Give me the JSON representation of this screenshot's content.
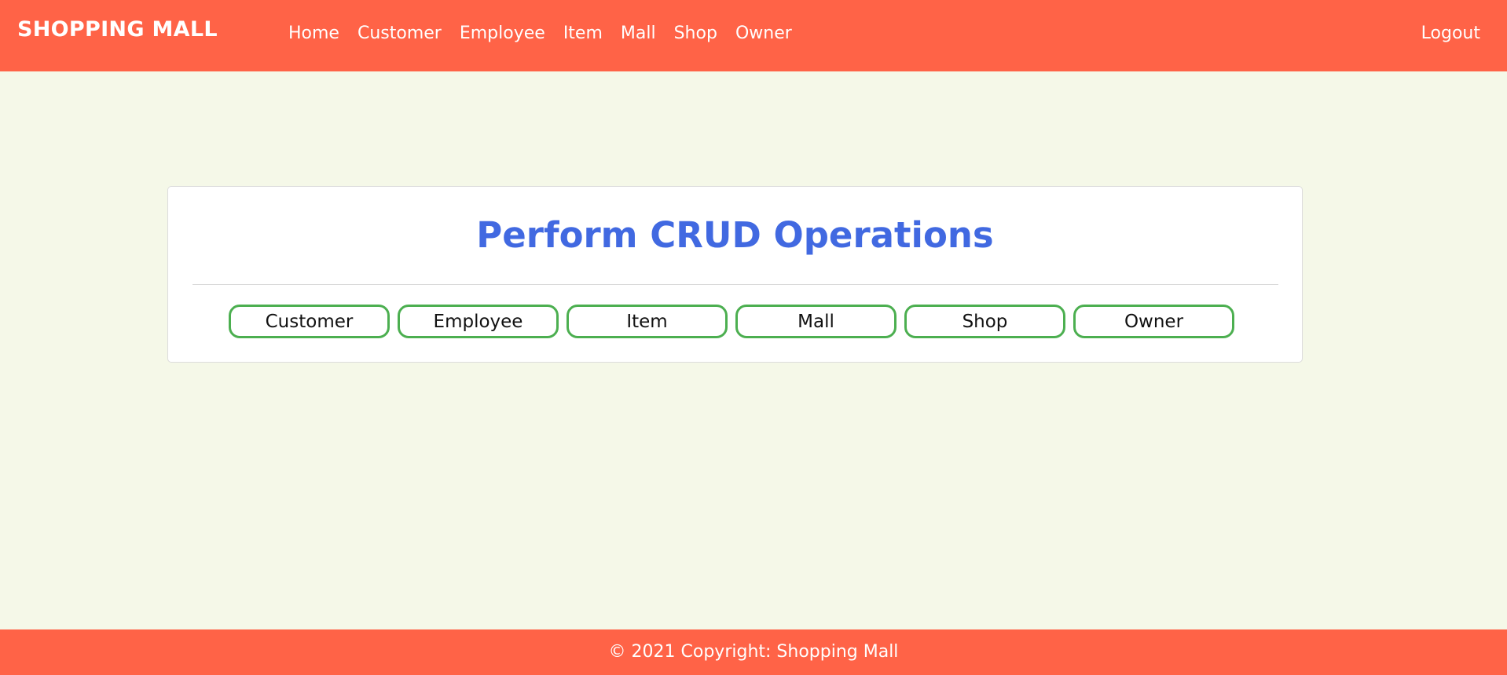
{
  "navbar": {
    "brand": "SHOPPING MALL",
    "links": [
      "Home",
      "Customer",
      "Employee",
      "Item",
      "Mall",
      "Shop",
      "Owner"
    ],
    "logout": "Logout",
    "color": "#ff6347"
  },
  "main": {
    "title": "Perform CRUD Operations",
    "title_color": "#4169e1",
    "buttons": [
      "Customer",
      "Employee",
      "Item",
      "Mall",
      "Shop",
      "Owner"
    ],
    "button_border_color": "#4caf50",
    "background": "#f5f8e8"
  },
  "footer": {
    "text": "© 2021 Copyright: Shopping Mall"
  }
}
